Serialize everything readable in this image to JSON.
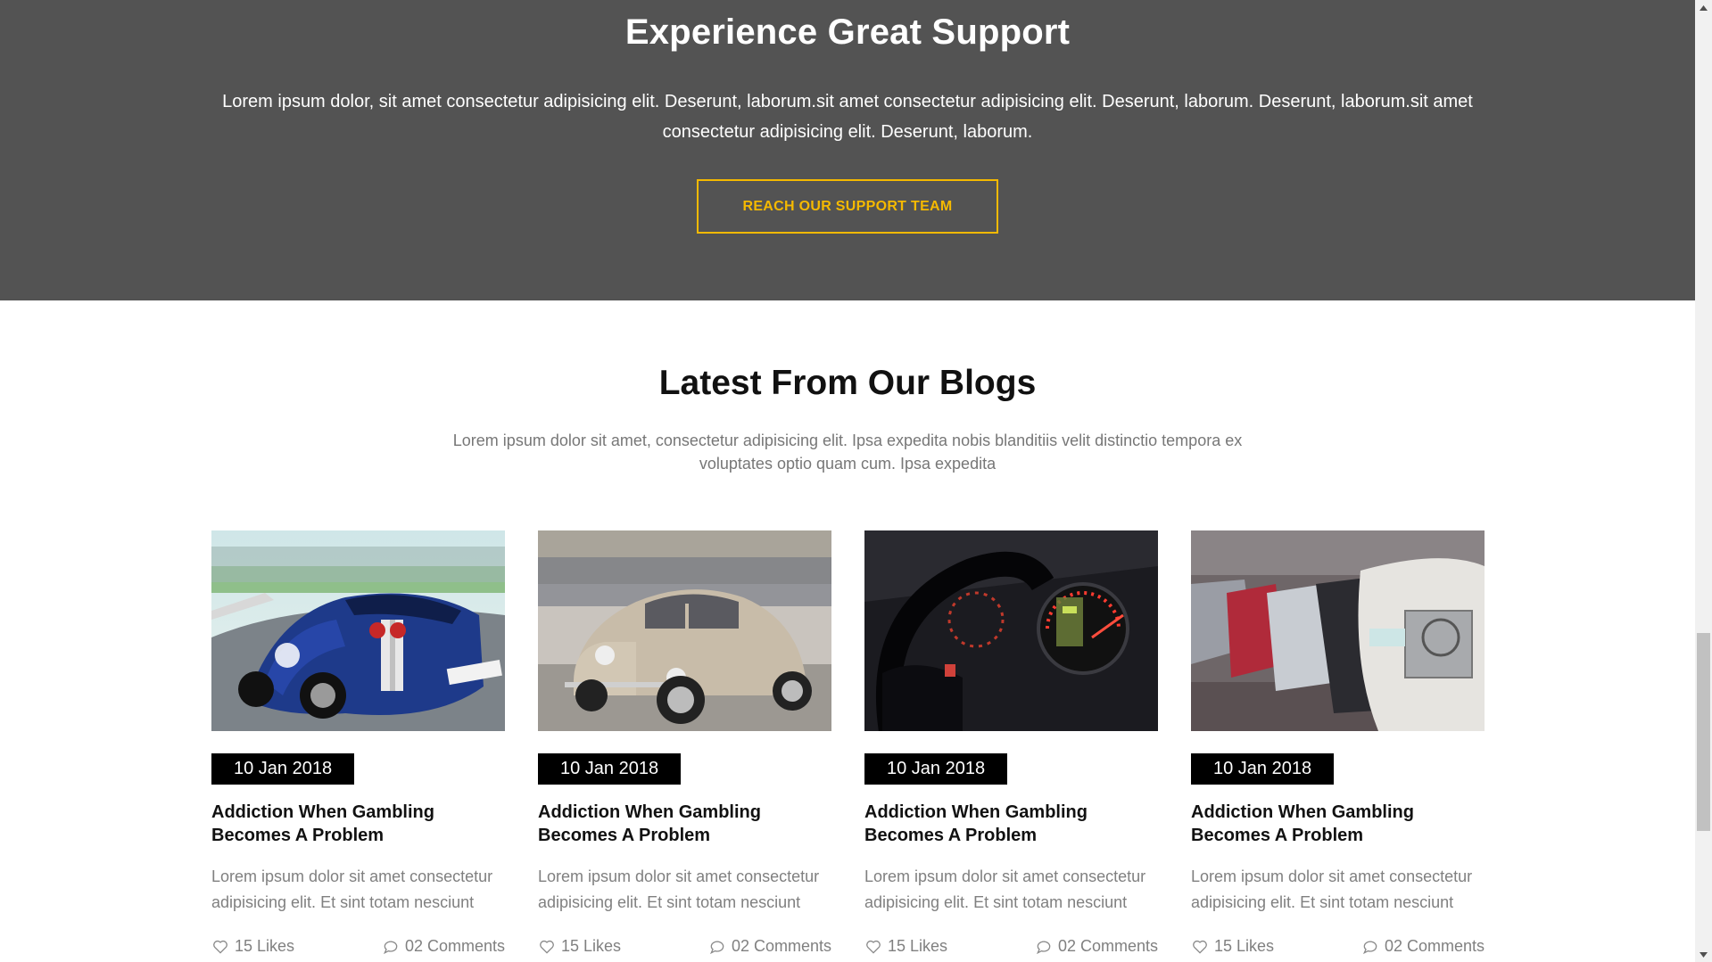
{
  "support": {
    "title": "Experience Great Support",
    "text": "Lorem ipsum dolor, sit amet consectetur adipisicing elit. Deserunt, laborum.sit amet consectetur adipisicing elit. Deserunt, laborum. Deserunt, laborum.sit amet consectetur adipisicing elit. Deserunt, laborum.",
    "button_label": "REACH OUR SUPPORT TEAM",
    "bg_color": "#535353",
    "accent_color": "#f5b900"
  },
  "blogs": {
    "title": "Latest From Our Blogs",
    "intro": "Lorem ipsum dolor sit amet, consectetur adipisicing elit. Ipsa expedita nobis blanditiis velit distinctio tempora ex voluptates optio quam cum. Ipsa expedita",
    "posts": [
      {
        "image": "blue sports car on race track",
        "date": "10 Jan 2018",
        "title": "Addiction When Gambling Becomes A Problem",
        "excerpt": "Lorem ipsum dolor sit amet consectetur adipisicing elit. Et sint totam nesciunt",
        "likes": "15 Likes",
        "comments": "02 Comments"
      },
      {
        "image": "beige vintage beetle car in parking lot",
        "date": "10 Jan 2018",
        "title": "Addiction When Gambling Becomes A Problem",
        "excerpt": "Lorem ipsum dolor sit amet consectetur adipisicing elit. Et sint totam nesciunt",
        "likes": "15 Likes",
        "comments": "02 Comments"
      },
      {
        "image": "car dashboard and steering wheel",
        "date": "10 Jan 2018",
        "title": "Addiction When Gambling Becomes A Problem",
        "excerpt": "Lorem ipsum dolor sit amet consectetur adipisicing elit. Et sint totam nesciunt",
        "likes": "15 Likes",
        "comments": "02 Comments"
      },
      {
        "image": "row of parked cars",
        "date": "10 Jan 2018",
        "title": "Addiction When Gambling Becomes A Problem",
        "excerpt": "Lorem ipsum dolor sit amet consectetur adipisicing elit. Et sint totam nesciunt",
        "likes": "15 Likes",
        "comments": "02 Comments"
      }
    ]
  },
  "icons": {
    "like": "heart-icon",
    "comment": "comment-bubble-icon"
  }
}
